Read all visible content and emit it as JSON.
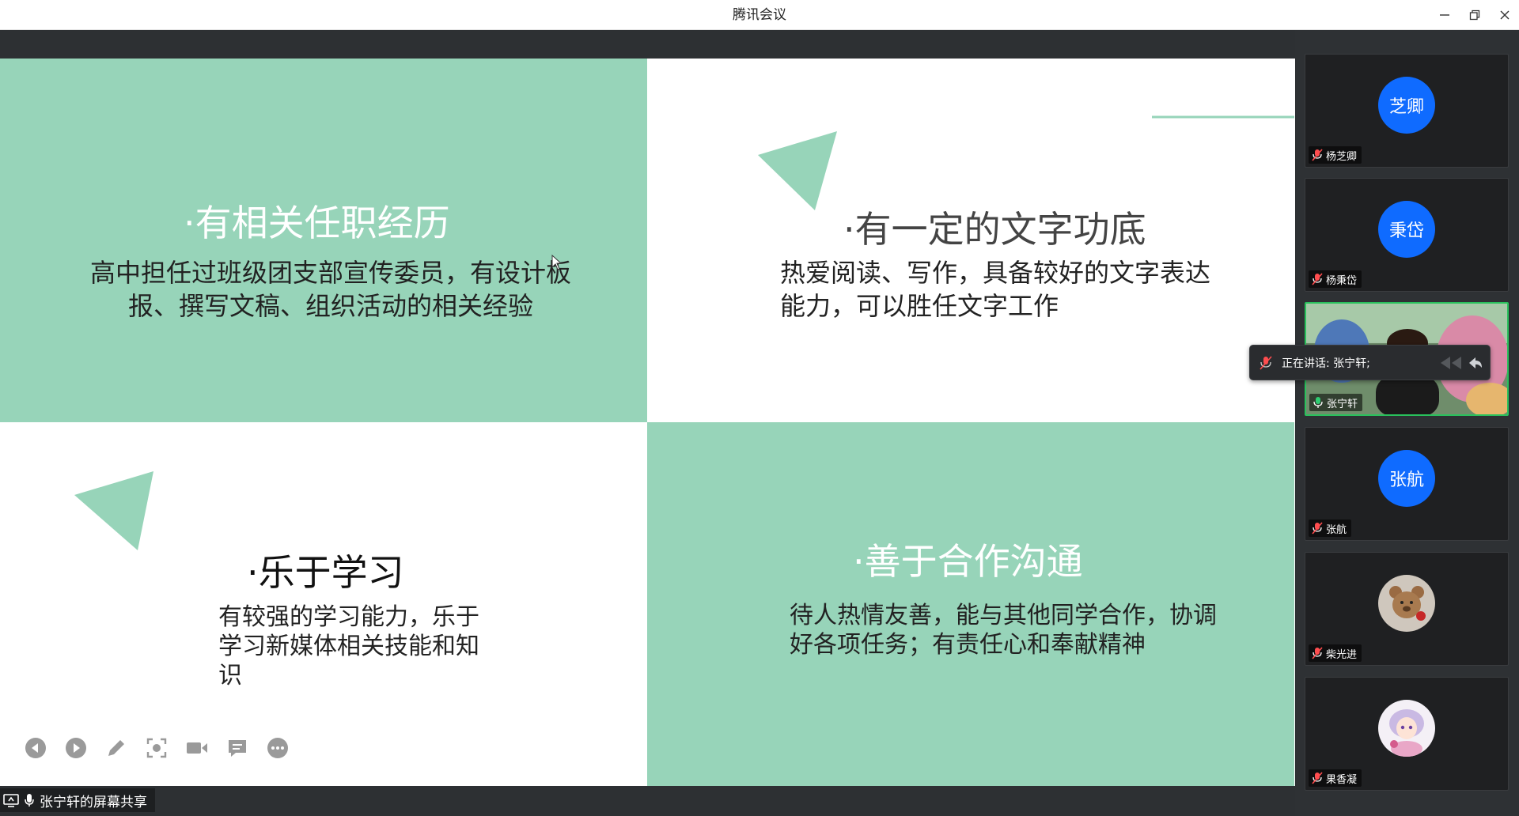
{
  "window": {
    "title": "腾讯会议"
  },
  "slide": {
    "q1": {
      "heading": "·有相关任职经历",
      "body": "高中担任过班级团支部宣传委员，有设计板报、撰写文稿、组织活动的相关经验"
    },
    "q2": {
      "heading": "·有一定的文字功底",
      "body": "热爱阅读、写作，具备较好的文字表达能力，可以胜任文字工作"
    },
    "q3": {
      "heading": "·乐于学习",
      "body": "有较强的学习能力，乐于学习新媒体相关技能和知识"
    },
    "q4": {
      "heading": "·善于合作沟通",
      "body": "待人热情友善，能与其他同学合作，协调好各项任务；有责任心和奉献精神"
    },
    "accent_color": "#97d4b9"
  },
  "slide_toolbar": {
    "icons": [
      "prev-icon",
      "next-icon",
      "pen-icon",
      "screenshot-icon",
      "camera-icon",
      "chat-icon",
      "more-icon"
    ]
  },
  "status": {
    "share_label": "张宁轩的屏幕共享"
  },
  "speaking": {
    "label": "正在讲话: 张宁轩;"
  },
  "participants": [
    {
      "avatar_text": "芝卿",
      "name": "杨芝卿",
      "muted": true
    },
    {
      "avatar_text": "秉岱",
      "name": "杨秉岱",
      "muted": true
    },
    {
      "avatar_text": "",
      "name": "张宁轩",
      "muted": false,
      "video": true
    },
    {
      "avatar_text": "张航",
      "name": "张航",
      "muted": true
    },
    {
      "avatar_text": "",
      "name": "柴光进",
      "muted": true,
      "image": "teddy-bear-avatar"
    },
    {
      "avatar_text": "",
      "name": "果香凝",
      "muted": true,
      "image": "anime-avatar"
    }
  ]
}
